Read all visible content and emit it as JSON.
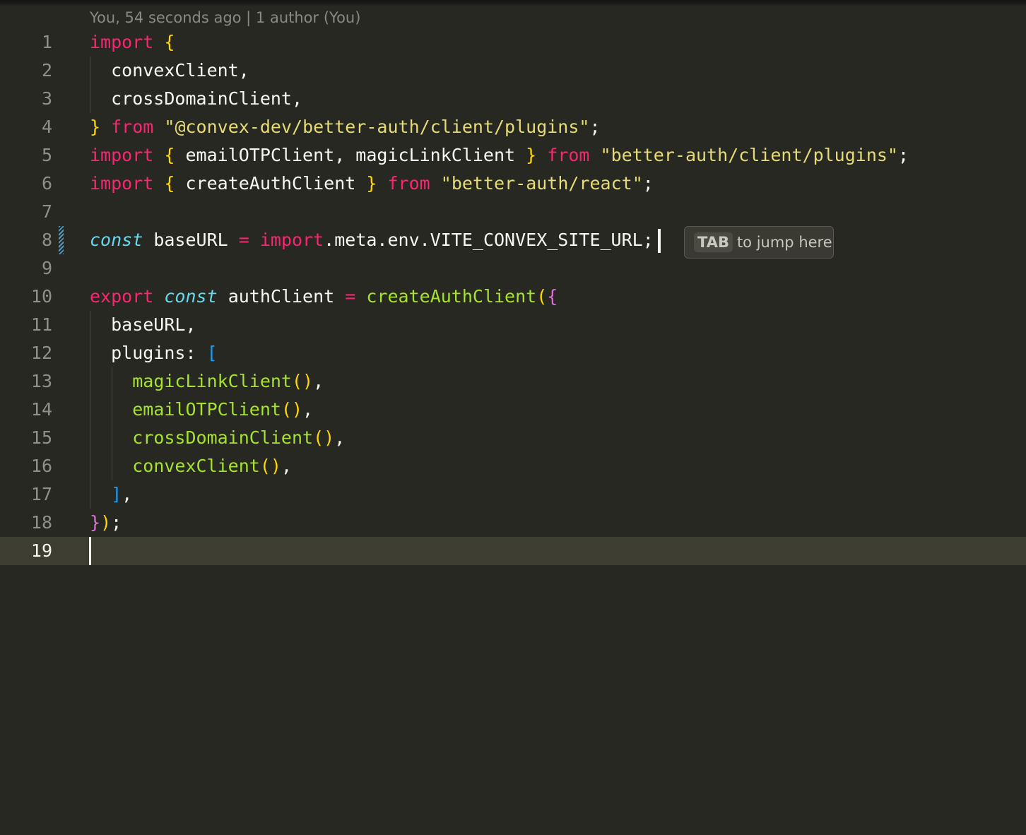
{
  "blame": {
    "text": "You, 54 seconds ago | 1 author (You)"
  },
  "hint": {
    "key": "TAB",
    "text": "to jump here"
  },
  "colors": {
    "background": "#272822",
    "current_line": "#3e3d32",
    "keyword": "#f92672",
    "storage": "#66d9ef",
    "string": "#e6db74",
    "function": "#a6e22e",
    "bracket_level1": "#ffd700",
    "bracket_level2": "#da70d6",
    "bracket_level3": "#179fff"
  },
  "lines": [
    {
      "n": "1",
      "tokens": [
        {
          "t": "import",
          "c": "kw"
        },
        {
          "t": " ",
          "c": ""
        },
        {
          "t": "{",
          "c": "b1"
        }
      ]
    },
    {
      "n": "2",
      "tokens": [
        {
          "t": "  convexClient,",
          "c": ""
        }
      ]
    },
    {
      "n": "3",
      "tokens": [
        {
          "t": "  crossDomainClient,",
          "c": ""
        }
      ]
    },
    {
      "n": "4",
      "tokens": [
        {
          "t": "}",
          "c": "b1"
        },
        {
          "t": " ",
          "c": ""
        },
        {
          "t": "from",
          "c": "kw"
        },
        {
          "t": " ",
          "c": ""
        },
        {
          "t": "\"@convex-dev/better-auth/client/plugins\"",
          "c": "str"
        },
        {
          "t": ";",
          "c": ""
        }
      ]
    },
    {
      "n": "5",
      "tokens": [
        {
          "t": "import",
          "c": "kw"
        },
        {
          "t": " ",
          "c": ""
        },
        {
          "t": "{",
          "c": "b1"
        },
        {
          "t": " emailOTPClient, magicLinkClient ",
          "c": ""
        },
        {
          "t": "}",
          "c": "b1"
        },
        {
          "t": " ",
          "c": ""
        },
        {
          "t": "from",
          "c": "kw"
        },
        {
          "t": " ",
          "c": ""
        },
        {
          "t": "\"better-auth/client/plugins\"",
          "c": "str"
        },
        {
          "t": ";",
          "c": ""
        }
      ]
    },
    {
      "n": "6",
      "tokens": [
        {
          "t": "import",
          "c": "kw"
        },
        {
          "t": " ",
          "c": ""
        },
        {
          "t": "{",
          "c": "b1"
        },
        {
          "t": " createAuthClient ",
          "c": ""
        },
        {
          "t": "}",
          "c": "b1"
        },
        {
          "t": " ",
          "c": ""
        },
        {
          "t": "from",
          "c": "kw"
        },
        {
          "t": " ",
          "c": ""
        },
        {
          "t": "\"better-auth/react\"",
          "c": "str"
        },
        {
          "t": ";",
          "c": ""
        }
      ]
    },
    {
      "n": "7",
      "tokens": []
    },
    {
      "n": "8",
      "dirty": true,
      "ghost_caret": true,
      "tokens": [
        {
          "t": "const",
          "c": "st"
        },
        {
          "t": " baseURL ",
          "c": ""
        },
        {
          "t": "=",
          "c": "kw"
        },
        {
          "t": " ",
          "c": ""
        },
        {
          "t": "import",
          "c": "kw"
        },
        {
          "t": ".meta.env.VITE_CONVEX_SITE_URL;",
          "c": ""
        }
      ]
    },
    {
      "n": "9",
      "tokens": []
    },
    {
      "n": "10",
      "tokens": [
        {
          "t": "export",
          "c": "kw"
        },
        {
          "t": " ",
          "c": ""
        },
        {
          "t": "const",
          "c": "st"
        },
        {
          "t": " authClient ",
          "c": ""
        },
        {
          "t": "=",
          "c": "kw"
        },
        {
          "t": " ",
          "c": ""
        },
        {
          "t": "createAuthClient",
          "c": "fn"
        },
        {
          "t": "(",
          "c": "b1"
        },
        {
          "t": "{",
          "c": "b2"
        }
      ]
    },
    {
      "n": "11",
      "tokens": [
        {
          "t": "  baseURL,",
          "c": ""
        }
      ]
    },
    {
      "n": "12",
      "tokens": [
        {
          "t": "  plugins: ",
          "c": ""
        },
        {
          "t": "[",
          "c": "b3"
        }
      ]
    },
    {
      "n": "13",
      "tokens": [
        {
          "t": "    ",
          "c": ""
        },
        {
          "t": "magicLinkClient",
          "c": "fn"
        },
        {
          "t": "()",
          "c": "b1"
        },
        {
          "t": ",",
          "c": ""
        }
      ]
    },
    {
      "n": "14",
      "tokens": [
        {
          "t": "    ",
          "c": ""
        },
        {
          "t": "emailOTPClient",
          "c": "fn"
        },
        {
          "t": "()",
          "c": "b1"
        },
        {
          "t": ",",
          "c": ""
        }
      ]
    },
    {
      "n": "15",
      "tokens": [
        {
          "t": "    ",
          "c": ""
        },
        {
          "t": "crossDomainClient",
          "c": "fn"
        },
        {
          "t": "()",
          "c": "b1"
        },
        {
          "t": ",",
          "c": ""
        }
      ]
    },
    {
      "n": "16",
      "tokens": [
        {
          "t": "    ",
          "c": ""
        },
        {
          "t": "convexClient",
          "c": "fn"
        },
        {
          "t": "()",
          "c": "b1"
        },
        {
          "t": ",",
          "c": ""
        }
      ]
    },
    {
      "n": "17",
      "tokens": [
        {
          "t": "  ",
          "c": ""
        },
        {
          "t": "]",
          "c": "b3"
        },
        {
          "t": ",",
          "c": ""
        }
      ]
    },
    {
      "n": "18",
      "tokens": [
        {
          "t": "}",
          "c": "b2"
        },
        {
          "t": ")",
          "c": "b1"
        },
        {
          "t": ";",
          "c": ""
        }
      ]
    },
    {
      "n": "19",
      "current": true,
      "tokens": []
    }
  ]
}
